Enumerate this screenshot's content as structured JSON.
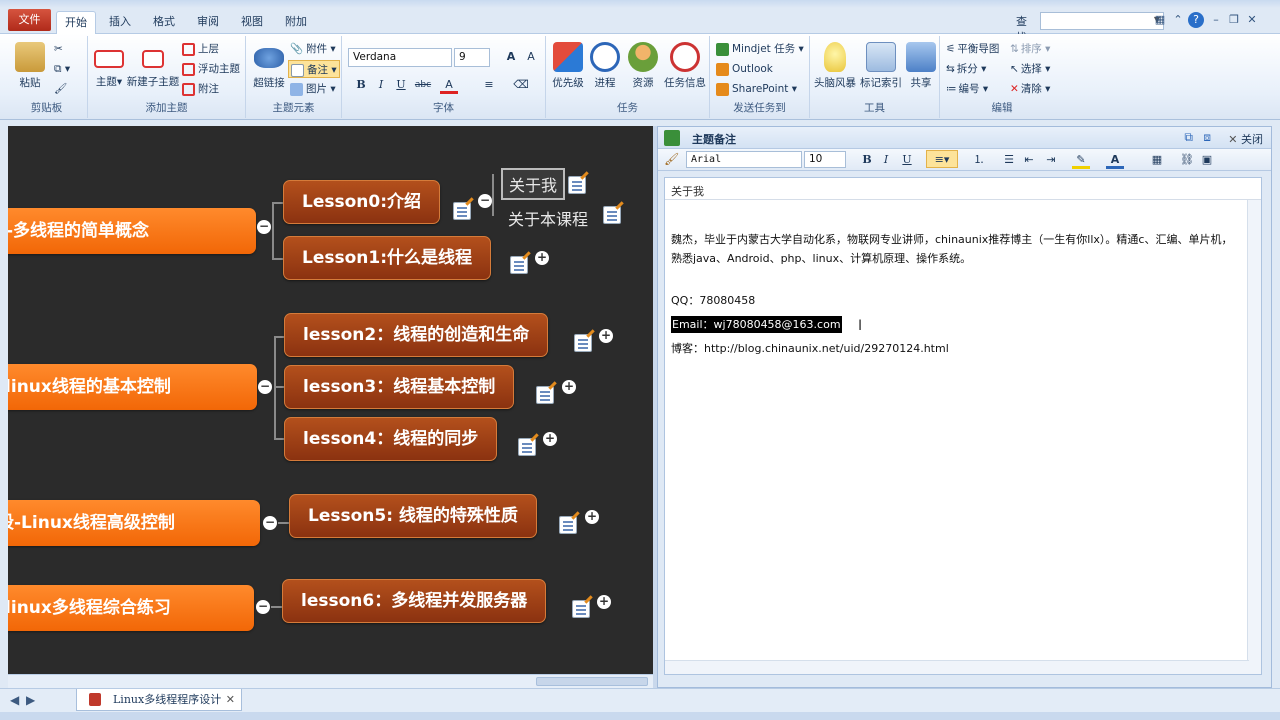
{
  "ribbon_tabs": {
    "file": "文件",
    "home": "开始",
    "insert": "插入",
    "format": "格式",
    "review": "审阅",
    "view": "视图",
    "addins": "附加"
  },
  "search": {
    "label": "查找",
    "value": ""
  },
  "clipboard": {
    "paste": "粘贴",
    "group": "剪贴板"
  },
  "add_topic": {
    "topic": "主题",
    "subtopic": "新建子主题",
    "above": "上层",
    "floating": "浮动主题",
    "callout": "附注",
    "group": "添加主题"
  },
  "topic_elements": {
    "hyperlink": "超链接",
    "attachment": "附件",
    "notes": "备注",
    "picture": "图片",
    "group": "主题元素"
  },
  "font": {
    "name": "Verdana",
    "size": "9",
    "bold": "B",
    "italic": "I",
    "underline": "U",
    "strike": "abc",
    "group": "字体"
  },
  "task": {
    "priority": "优先级",
    "progress": "进程",
    "resource": "资源",
    "taskinfo": "任务信息",
    "group": "任务"
  },
  "send_tasks": {
    "mindjet": "Mindjet 任务",
    "outlook": "Outlook",
    "sharepoint": "SharePoint",
    "group": "发送任务到"
  },
  "tools": {
    "brainstorm": "头脑风暴",
    "index": "标记索引",
    "share": "共享",
    "group": "工具"
  },
  "edit": {
    "balance": "平衡导图",
    "split": "拆分",
    "numbering": "编号",
    "sort": "排序",
    "select": "选择",
    "clear": "清除",
    "group": "编辑"
  },
  "mindmap": {
    "branches": [
      {
        "main": "第一阶段-多线程的简单概念",
        "subs": [
          "Lesson0:介绍",
          "Lesson1:什么是线程"
        ]
      },
      {
        "main": "第二阶段-linux线程的基本控制",
        "subs": [
          "lesson2：线程的创造和生命",
          "lesson3：线程基本控制",
          "lesson4：线程的同步"
        ]
      },
      {
        "main": "第三阶段-Linux线程高级控制",
        "subs": [
          "Lesson5: 线程的特殊性质"
        ]
      },
      {
        "main": "第四阶段-linux多线程综合练习",
        "subs": [
          "lesson6：多线程并发服务器"
        ]
      }
    ],
    "lesson0_children": [
      "关于我",
      "关于本课程"
    ]
  },
  "notes_panel": {
    "title": "主题备注",
    "close": "关闭",
    "font_name": "Arial",
    "font_size": "10",
    "topic": "关于我",
    "para1": "魏杰，毕业于内蒙古大学自动化系，物联网专业讲师，chinaunix推荐博主（一生有你llx）。精通c、汇编、单片机，熟悉java、Android、php、linux、计算机原理、操作系统。",
    "qq": "QQ：78080458",
    "email": "Email：wj78080458@163.com",
    "blog": "博客：http://blog.chinaunix.net/uid/29270124.html"
  },
  "sheet_tab": "Linux多线程程序设计",
  "colors": {
    "main_topic": "#f26707",
    "sub_topic": "#8b3210",
    "canvas": "#2b2b2b",
    "file_tab": "#c0392b"
  }
}
